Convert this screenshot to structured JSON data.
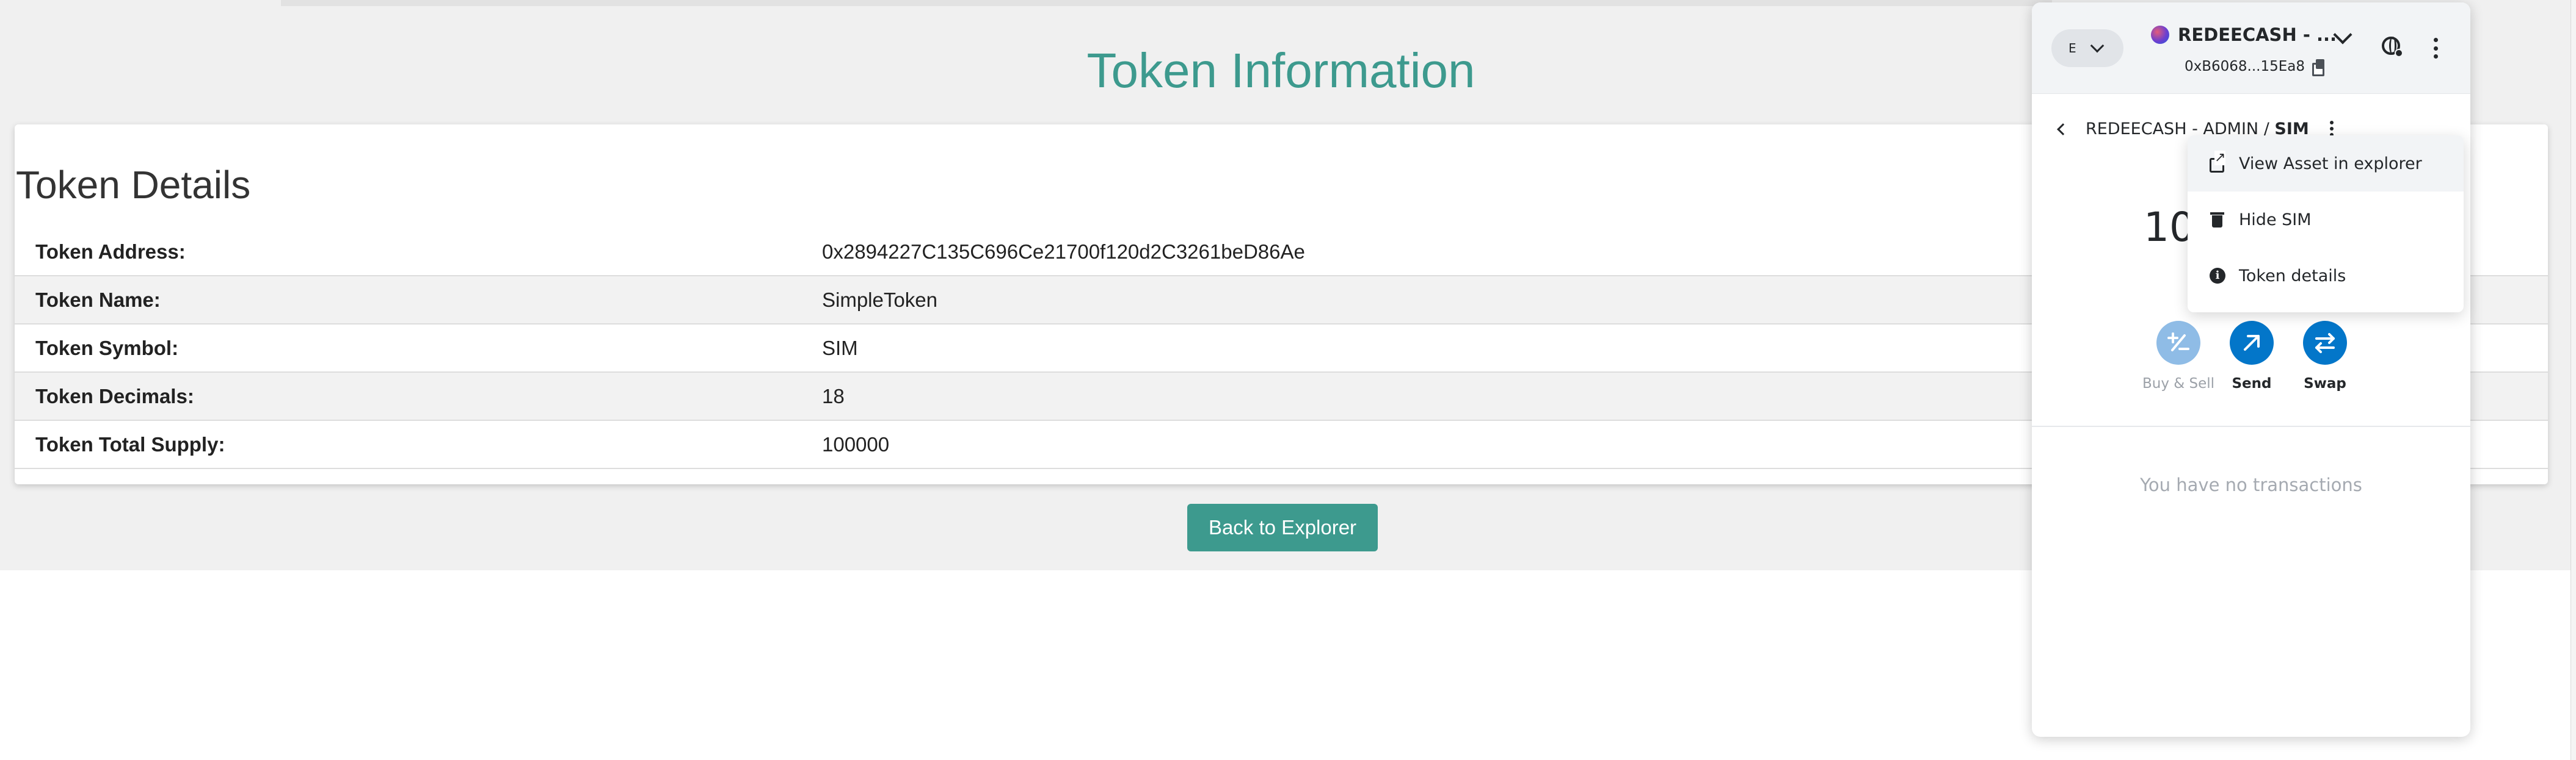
{
  "explorer": {
    "title": "Token Information",
    "card_title": "Token Details",
    "rows": [
      {
        "label": "Token Address:",
        "value": "0x2894227C135C696Ce21700f120d2C3261beD86Ae"
      },
      {
        "label": "Token Name:",
        "value": "SimpleToken"
      },
      {
        "label": "Token Symbol:",
        "value": "SIM"
      },
      {
        "label": "Token Decimals:",
        "value": "18"
      },
      {
        "label": "Token Total Supply:",
        "value": "100000"
      }
    ],
    "back_button": "Back to Explorer",
    "accent_color": "#3d9a8e"
  },
  "wallet": {
    "network_initial": "E",
    "account_name": "REDEECASH - ...",
    "account_address": "0xB6068...15Ea8",
    "breadcrumb_account": "REDEECASH - ADMIN / ",
    "breadcrumb_token": "SIM",
    "balance_partial": "10",
    "actions": [
      {
        "label": "Buy & Sell",
        "icon": "plus-minus-icon",
        "enabled": false
      },
      {
        "label": "Send",
        "icon": "arrow-up-right-icon",
        "enabled": true
      },
      {
        "label": "Swap",
        "icon": "swap-arrows-icon",
        "enabled": true
      }
    ],
    "empty_state": "You have no transactions",
    "primary_color": "#0376c9",
    "menu": [
      {
        "label": "View Asset in explorer",
        "icon": "external-link-icon"
      },
      {
        "label": "Hide SIM",
        "icon": "trash-icon"
      },
      {
        "label": "Token details",
        "icon": "info-icon"
      }
    ]
  }
}
